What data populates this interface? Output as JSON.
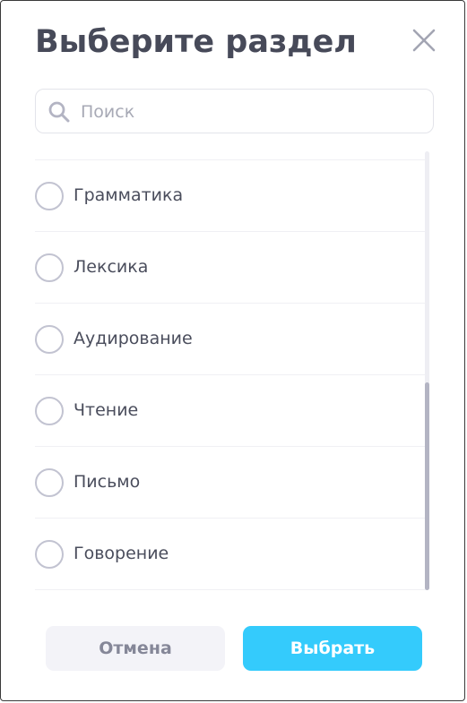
{
  "dialog": {
    "title": "Выберите раздел",
    "close_icon": "close-icon"
  },
  "search": {
    "icon": "search-icon",
    "placeholder": "Поиск",
    "value": ""
  },
  "list": {
    "items": [
      {
        "label": "Грамматика",
        "selected": false
      },
      {
        "label": "Лексика",
        "selected": false
      },
      {
        "label": "Аудирование",
        "selected": false
      },
      {
        "label": "Чтение",
        "selected": false
      },
      {
        "label": "Письмо",
        "selected": false
      },
      {
        "label": "Говорение",
        "selected": false
      }
    ]
  },
  "buttons": {
    "cancel_label": "Отмена",
    "select_label": "Выбрать"
  },
  "colors": {
    "accent": "#34cbfc",
    "title": "#474a59",
    "radio_border": "#c2c3d1"
  }
}
